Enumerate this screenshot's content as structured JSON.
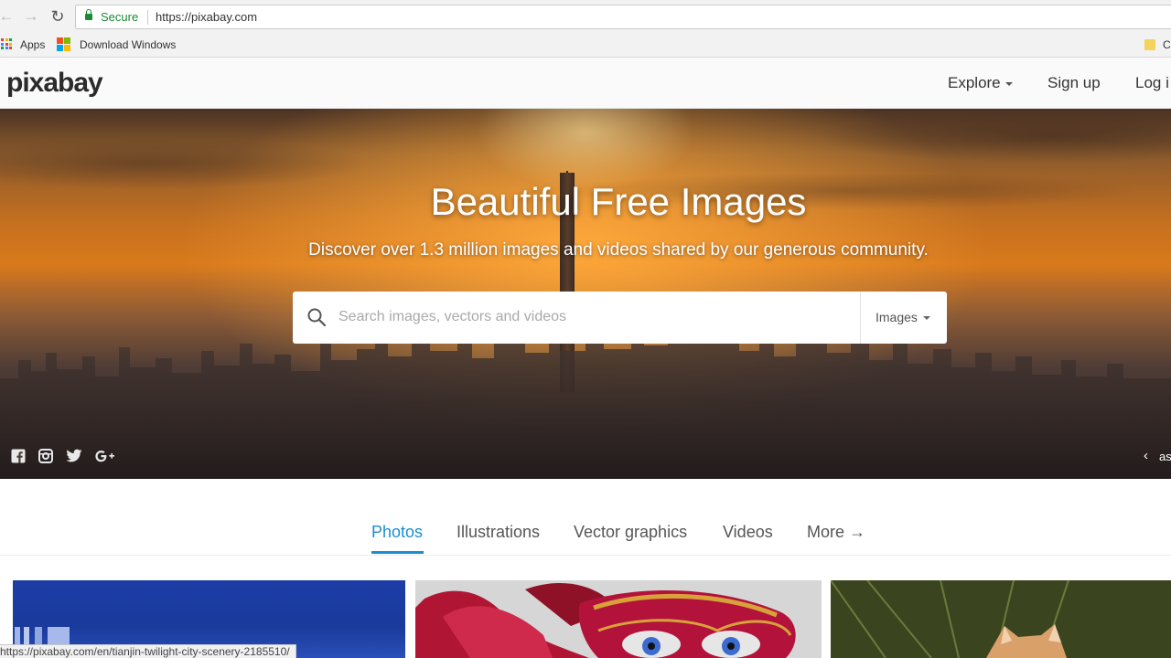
{
  "browser": {
    "secure_label": "Secure",
    "url": "https://pixabay.com",
    "bookmarks": [
      {
        "label": "Apps"
      },
      {
        "label": "Download Windows"
      },
      {
        "label": "C"
      }
    ],
    "status_url": "https://pixabay.com/en/tianjin-twilight-city-scenery-2185510/"
  },
  "header": {
    "logo": "pixabay",
    "nav": {
      "explore": "Explore",
      "signup": "Sign up",
      "login": "Log i"
    }
  },
  "hero": {
    "title": "Beautiful Free Images",
    "subtitle": "Discover over 1.3 million images and videos shared by our generous community.",
    "search": {
      "placeholder": "Search images, vectors and videos",
      "type_label": "Images"
    },
    "credit": "as"
  },
  "tabs": [
    {
      "label": "Photos",
      "active": true
    },
    {
      "label": "Illustrations",
      "active": false
    },
    {
      "label": "Vector graphics",
      "active": false
    },
    {
      "label": "Videos",
      "active": false
    },
    {
      "label": "More →",
      "active": false
    }
  ],
  "colors": {
    "accent": "#1a8ed0",
    "secure": "#1a8a34"
  }
}
